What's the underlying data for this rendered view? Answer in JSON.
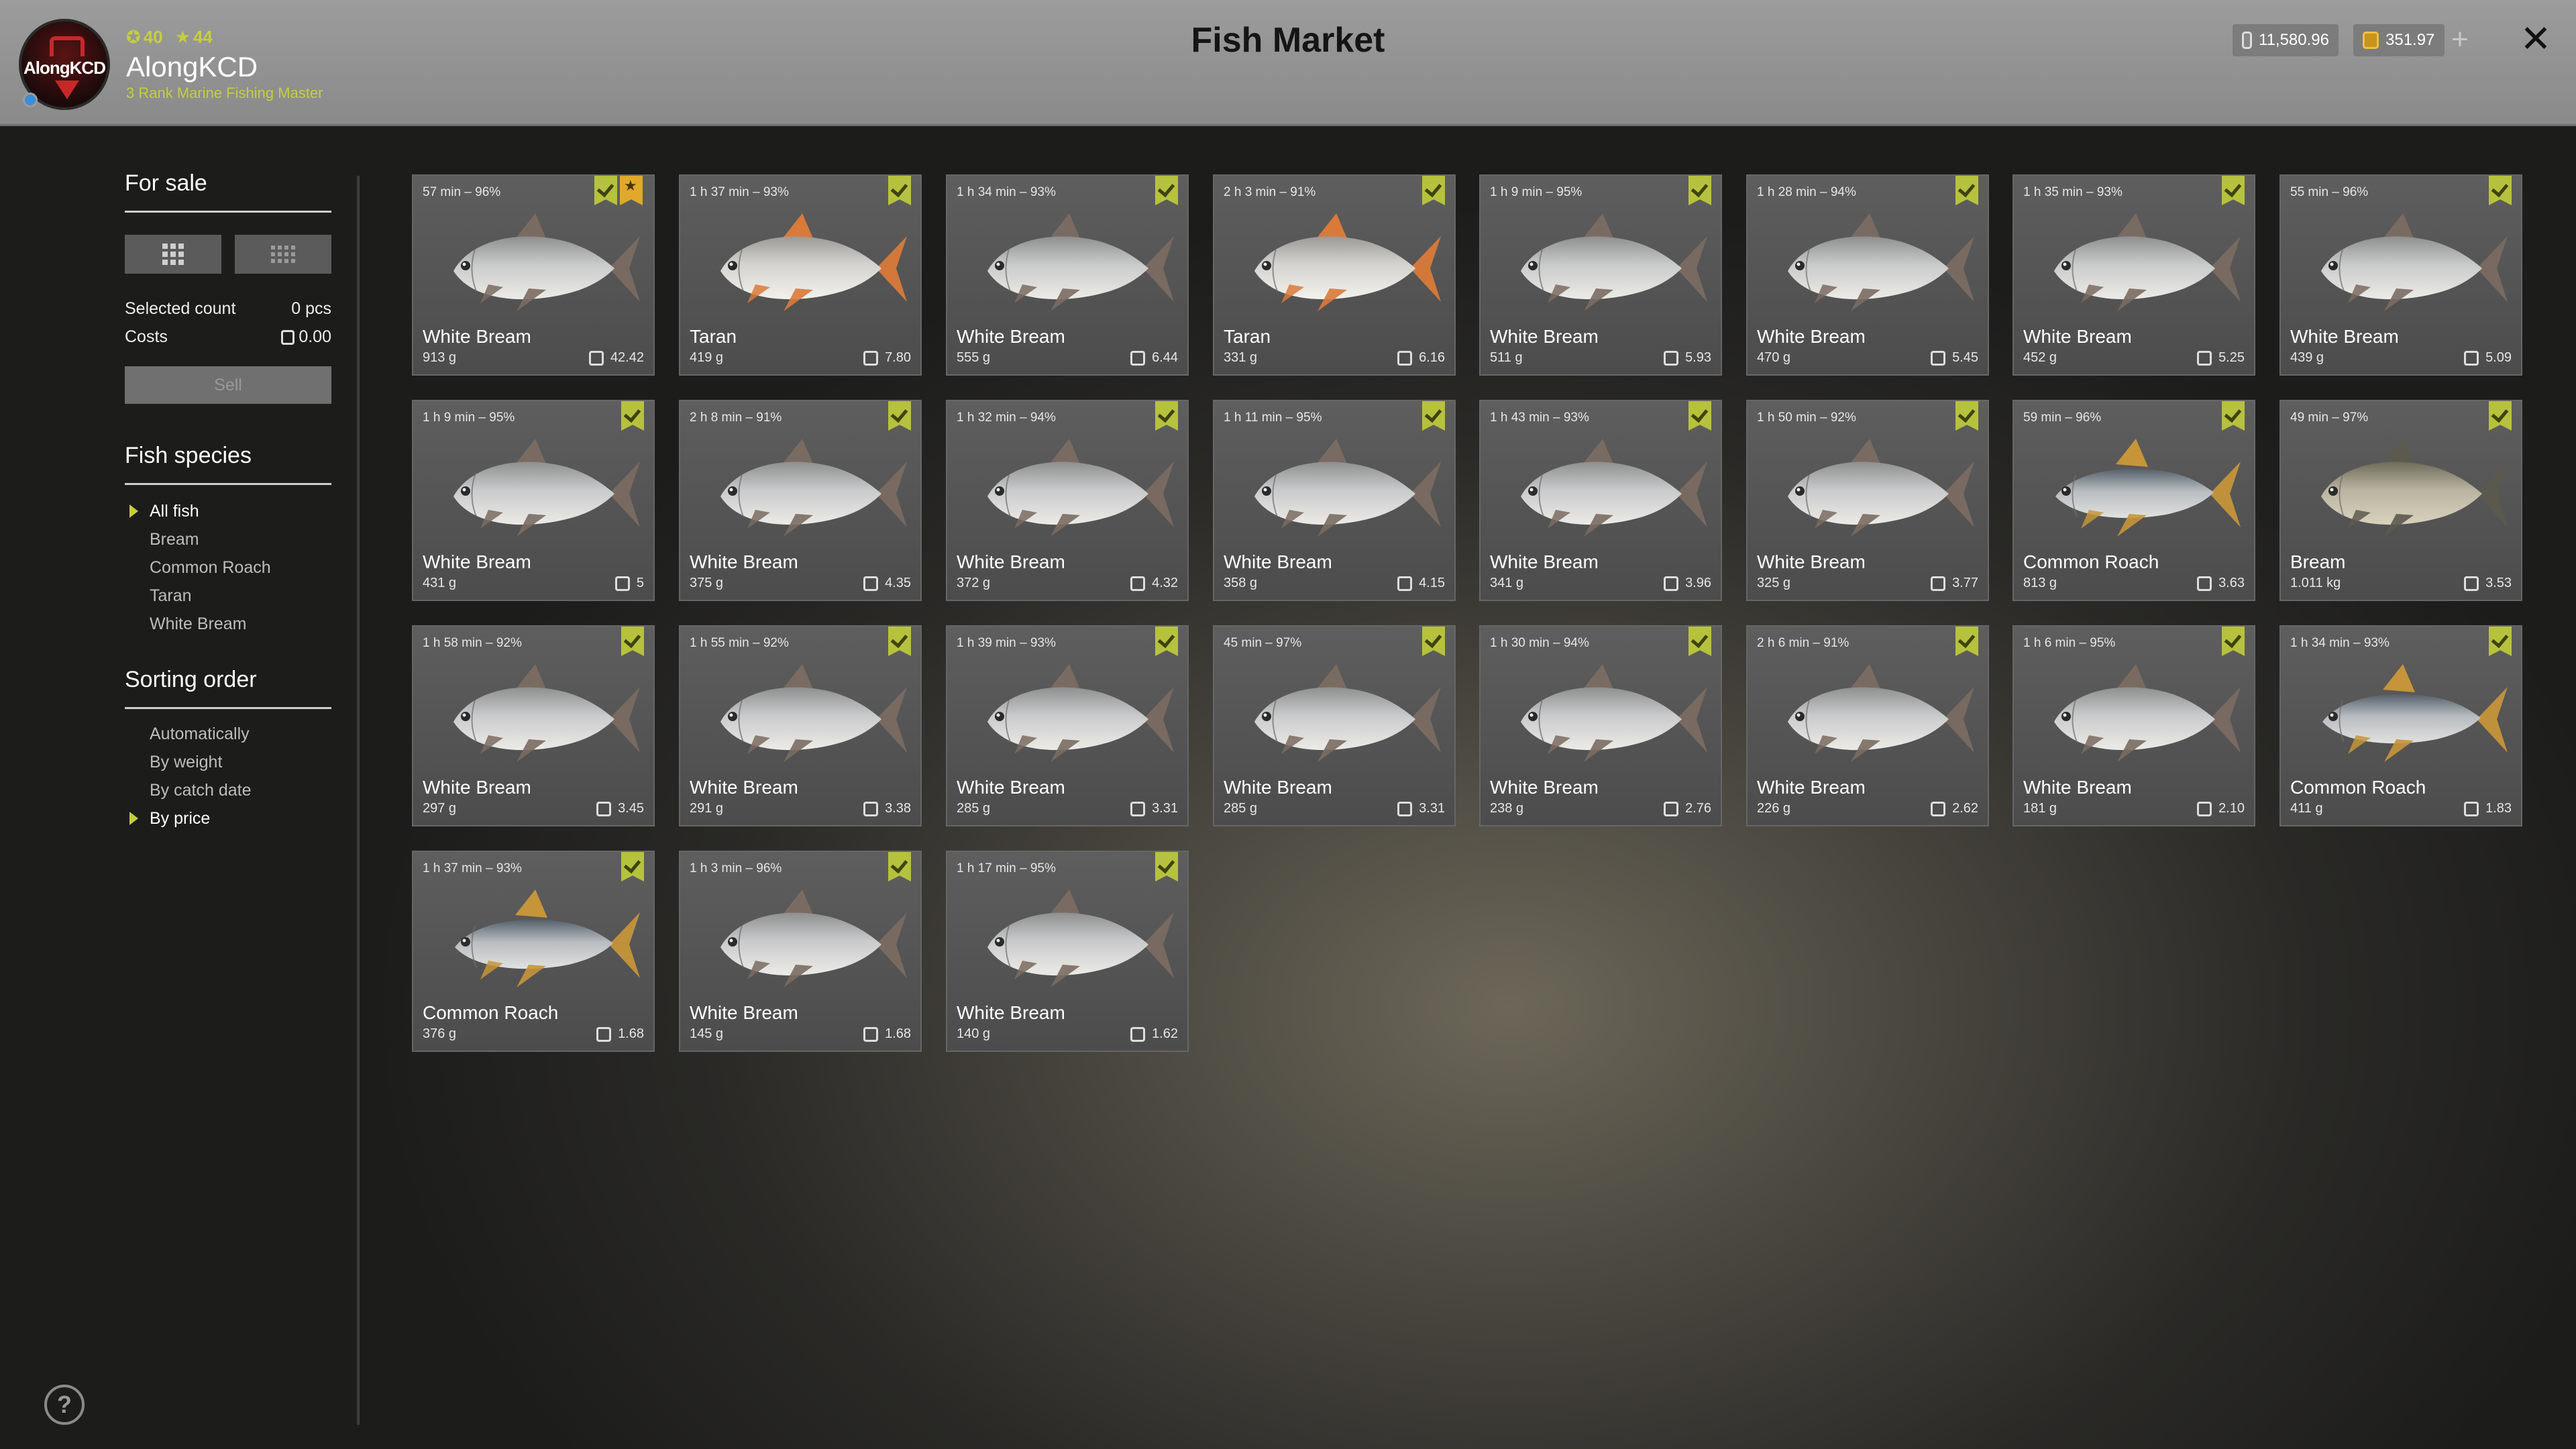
{
  "header": {
    "title": "Fish Market",
    "user": {
      "name": "AlongKCD",
      "rank": "3 Rank Marine Fishing Master",
      "level": "40",
      "stars": "44",
      "avatar_text": "AlongKCD"
    },
    "currency": {
      "silver": "11,580.96",
      "gold": "351.97"
    },
    "plus_label": "+",
    "close_label": "✕"
  },
  "sidebar": {
    "for_sale": "For sale",
    "selected_count_label": "Selected count",
    "selected_count_value": "0 pcs",
    "costs_label": "Costs",
    "costs_value": "0.00",
    "sell_label": "Sell",
    "fish_species_heading": "Fish species",
    "species": [
      "All fish",
      "Bream",
      "Common Roach",
      "Taran",
      "White Bream"
    ],
    "species_selected": "All fish",
    "sorting_heading": "Sorting order",
    "sorting": [
      "Automatically",
      "By weight",
      "By catch date",
      "By price"
    ],
    "sorting_selected": "By price"
  },
  "fish": [
    {
      "time": "57 min – 96%",
      "name": "White Bream",
      "weight": "913 g",
      "price": "42.42",
      "type": "white-bream",
      "starred": true
    },
    {
      "time": "1 h 37 min – 93%",
      "name": "Taran",
      "weight": "419 g",
      "price": "7.80",
      "type": "taran"
    },
    {
      "time": "1 h 34 min – 93%",
      "name": "White Bream",
      "weight": "555 g",
      "price": "6.44",
      "type": "white-bream"
    },
    {
      "time": "2 h 3 min – 91%",
      "name": "Taran",
      "weight": "331 g",
      "price": "6.16",
      "type": "taran"
    },
    {
      "time": "1 h 9 min – 95%",
      "name": "White Bream",
      "weight": "511 g",
      "price": "5.93",
      "type": "white-bream"
    },
    {
      "time": "1 h 28 min – 94%",
      "name": "White Bream",
      "weight": "470 g",
      "price": "5.45",
      "type": "white-bream"
    },
    {
      "time": "1 h 35 min – 93%",
      "name": "White Bream",
      "weight": "452 g",
      "price": "5.25",
      "type": "white-bream"
    },
    {
      "time": "55 min – 96%",
      "name": "White Bream",
      "weight": "439 g",
      "price": "5.09",
      "type": "white-bream"
    },
    {
      "time": "1 h 9 min – 95%",
      "name": "White Bream",
      "weight": "431 g",
      "price": "5",
      "type": "white-bream"
    },
    {
      "time": "2 h 8 min – 91%",
      "name": "White Bream",
      "weight": "375 g",
      "price": "4.35",
      "type": "white-bream"
    },
    {
      "time": "1 h 32 min – 94%",
      "name": "White Bream",
      "weight": "372 g",
      "price": "4.32",
      "type": "white-bream"
    },
    {
      "time": "1 h 11 min – 95%",
      "name": "White Bream",
      "weight": "358 g",
      "price": "4.15",
      "type": "white-bream"
    },
    {
      "time": "1 h 43 min – 93%",
      "name": "White Bream",
      "weight": "341 g",
      "price": "3.96",
      "type": "white-bream"
    },
    {
      "time": "1 h 50 min – 92%",
      "name": "White Bream",
      "weight": "325 g",
      "price": "3.77",
      "type": "white-bream"
    },
    {
      "time": "59 min – 96%",
      "name": "Common Roach",
      "weight": "813 g",
      "price": "3.63",
      "type": "roach"
    },
    {
      "time": "49 min – 97%",
      "name": "Bream",
      "weight": "1.011 kg",
      "price": "3.53",
      "type": "bream"
    },
    {
      "time": "1 h 58 min – 92%",
      "name": "White Bream",
      "weight": "297 g",
      "price": "3.45",
      "type": "white-bream"
    },
    {
      "time": "1 h 55 min – 92%",
      "name": "White Bream",
      "weight": "291 g",
      "price": "3.38",
      "type": "white-bream"
    },
    {
      "time": "1 h 39 min – 93%",
      "name": "White Bream",
      "weight": "285 g",
      "price": "3.31",
      "type": "white-bream"
    },
    {
      "time": "45 min – 97%",
      "name": "White Bream",
      "weight": "285 g",
      "price": "3.31",
      "type": "white-bream"
    },
    {
      "time": "1 h 30 min – 94%",
      "name": "White Bream",
      "weight": "238 g",
      "price": "2.76",
      "type": "white-bream"
    },
    {
      "time": "2 h 6 min – 91%",
      "name": "White Bream",
      "weight": "226 g",
      "price": "2.62",
      "type": "white-bream"
    },
    {
      "time": "1 h 6 min – 95%",
      "name": "White Bream",
      "weight": "181 g",
      "price": "2.10",
      "type": "white-bream"
    },
    {
      "time": "1 h 34 min – 93%",
      "name": "Common Roach",
      "weight": "411 g",
      "price": "1.83",
      "type": "roach"
    },
    {
      "time": "1 h 37 min – 93%",
      "name": "Common Roach",
      "weight": "376 g",
      "price": "1.68",
      "type": "roach"
    },
    {
      "time": "1 h 3 min – 96%",
      "name": "White Bream",
      "weight": "145 g",
      "price": "1.68",
      "type": "white-bream"
    },
    {
      "time": "1 h 17 min – 95%",
      "name": "White Bream",
      "weight": "140 g",
      "price": "1.62",
      "type": "white-bream"
    }
  ],
  "help_label": "?",
  "colors": {
    "accent": "#b6c23d",
    "star": "#e0a92a",
    "card": "#575757"
  }
}
